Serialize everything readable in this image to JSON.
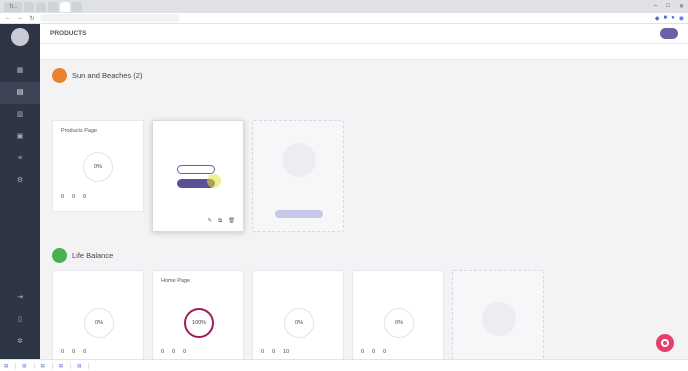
{
  "browser": {
    "tabs": [
      {
        "label": "Tr...",
        "active": false
      },
      {
        "label": "",
        "active": false
      },
      {
        "label": "",
        "active": false
      },
      {
        "label": "",
        "active": false
      },
      {
        "label": "",
        "active": true
      },
      {
        "label": "",
        "active": false
      }
    ],
    "url": "",
    "bookmarks": [
      "",
      "",
      "",
      "",
      "",
      "",
      "",
      "",
      "",
      "",
      "",
      ""
    ]
  },
  "sidebar": {
    "items": [
      {
        "label": "",
        "icon": "grid-icon"
      },
      {
        "label": "",
        "icon": "document-icon"
      },
      {
        "label": "",
        "icon": "chart-icon"
      },
      {
        "label": "",
        "icon": "folder-icon"
      },
      {
        "label": "",
        "icon": "list-icon"
      },
      {
        "label": "",
        "icon": "settings-icon"
      }
    ],
    "bottom": [
      {
        "label": "",
        "icon": "logout-icon"
      },
      {
        "label": "",
        "icon": "phone-icon"
      },
      {
        "label": "",
        "icon": "gear-icon"
      }
    ]
  },
  "header": {
    "title": "PRODUCTS",
    "lang": "",
    "add_label": ""
  },
  "filters": {
    "items": [
      "",
      "",
      ""
    ],
    "right": ""
  },
  "projects": [
    {
      "name": "Sun and Beaches (2)",
      "initial": "",
      "color": "#e8822c",
      "sub": "",
      "cards": [
        {
          "title": "Products Page",
          "sub": "",
          "progress": "0%",
          "stats": [
            {
              "n": "0",
              "l": ""
            },
            {
              "n": "0",
              "l": ""
            },
            {
              "n": "0",
              "l": ""
            }
          ]
        },
        {
          "title": "",
          "sub": "",
          "buttons": [
            "",
            ""
          ]
        }
      ]
    },
    {
      "name": "Life Balance",
      "initial": "",
      "color": "#4caf50",
      "sub": "",
      "cards": [
        {
          "title": "",
          "sub": "",
          "progress": "0%",
          "stats": [
            {
              "n": "0",
              "l": ""
            },
            {
              "n": "0",
              "l": ""
            },
            {
              "n": "0",
              "l": ""
            }
          ]
        },
        {
          "title": "Home Page",
          "sub": "",
          "progress": "100%",
          "stats": [
            {
              "n": "0",
              "l": ""
            },
            {
              "n": "0",
              "l": ""
            },
            {
              "n": "0",
              "l": ""
            }
          ]
        },
        {
          "title": "",
          "sub": "",
          "progress": "0%",
          "stats": [
            {
              "n": "0",
              "l": ""
            },
            {
              "n": "0",
              "l": ""
            },
            {
              "n": "10",
              "l": ""
            }
          ]
        },
        {
          "title": "",
          "sub": "",
          "progress": "0%",
          "stats": [
            {
              "n": "0",
              "l": ""
            },
            {
              "n": "0",
              "l": ""
            },
            {
              "n": "0",
              "l": ""
            }
          ]
        }
      ]
    }
  ],
  "downloads": {
    "items": [
      "",
      "",
      "",
      "",
      ""
    ],
    "show_all": ""
  },
  "colors": {
    "sidebar": "#2e3545",
    "accent": "#6b5fa8",
    "highlight": "#a01c5c",
    "chat": "#e4416a"
  }
}
